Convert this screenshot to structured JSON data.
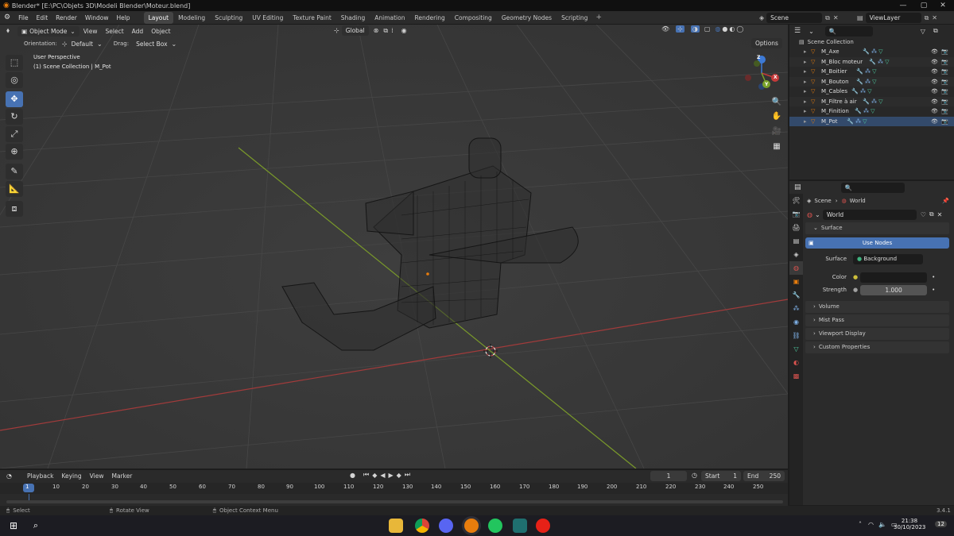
{
  "window": {
    "title": "Blender* [E:\\PC\\Objets 3D\\Modeli Blender\\Moteur.blend]"
  },
  "menu": [
    "File",
    "Edit",
    "Render",
    "Window",
    "Help"
  ],
  "workspaces": [
    "Layout",
    "Modeling",
    "Sculpting",
    "UV Editing",
    "Texture Paint",
    "Shading",
    "Animation",
    "Rendering",
    "Compositing",
    "Geometry Nodes",
    "Scripting"
  ],
  "scene": {
    "name": "Scene",
    "view_layer": "ViewLayer"
  },
  "viewport": {
    "mode": "Object Mode",
    "menus": [
      "View",
      "Select",
      "Add",
      "Object"
    ],
    "transform": "Global",
    "orientation_label": "Orientation:",
    "orientation_value": "Default",
    "drag_label": "Drag:",
    "drag_value": "Select Box",
    "options": "Options",
    "perspective": "User Perspective",
    "collection_info": "(1) Scene Collection | M_Pot",
    "gizmo": {
      "x": "X",
      "y": "Y",
      "z": "Z"
    }
  },
  "outliner": {
    "root": "Scene Collection",
    "items": [
      "M_Axe",
      "M_Bloc moteur",
      "M_Boitier",
      "M_Bouton",
      "M_Cables",
      "M_Filtre à air",
      "M_Finition",
      "M_Pot"
    ]
  },
  "properties": {
    "breadcrumb_scene": "Scene",
    "breadcrumb_world": "World",
    "world_name": "World",
    "surface_header": "Surface",
    "use_nodes": "Use Nodes",
    "surface_label": "Surface",
    "surface_value": "Background",
    "color_label": "Color",
    "strength_label": "Strength",
    "strength_value": "1.000",
    "panels": [
      "Volume",
      "Mist Pass",
      "Viewport Display",
      "Custom Properties"
    ]
  },
  "timeline": {
    "menus": [
      "Playback",
      "Keying",
      "View",
      "Marker"
    ],
    "current_frame": "1",
    "start_label": "Start",
    "start": "1",
    "end_label": "End",
    "end": "250",
    "ticks": [
      "1",
      "10",
      "20",
      "30",
      "40",
      "50",
      "60",
      "70",
      "80",
      "90",
      "100",
      "110",
      "120",
      "130",
      "140",
      "150",
      "160",
      "170",
      "180",
      "190",
      "200",
      "210",
      "220",
      "230",
      "240",
      "250"
    ]
  },
  "status": {
    "select": "Select",
    "rotate": "Rotate View",
    "context": "Object Context Menu",
    "version": "3.4.1"
  },
  "taskbar": {
    "time": "21:38",
    "date": "30/10/2023",
    "notif": "12"
  },
  "colors": {
    "accent": "#4772b3",
    "xaxis": "#a23b3b",
    "yaxis": "#7a9a2a",
    "orange": "#e87d0d"
  }
}
